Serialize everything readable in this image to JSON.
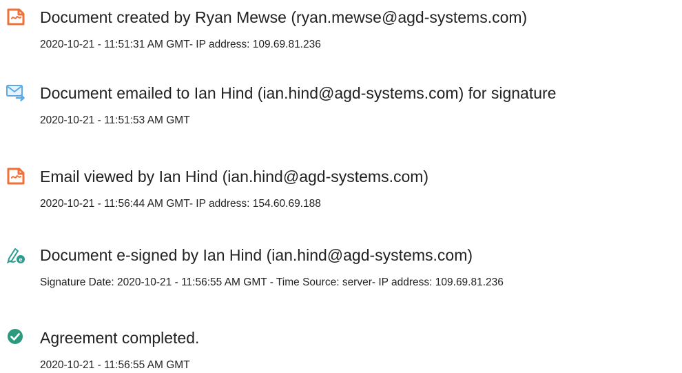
{
  "events": [
    {
      "icon": "document-created-icon",
      "title": "Document created by Ryan Mewse (ryan.mewse@agd-systems.com)",
      "detail": "2020-10-21 - 11:51:31 AM GMT- IP address: 109.69.81.236"
    },
    {
      "icon": "email-sent-icon",
      "title": "Document emailed to Ian Hind (ian.hind@agd-systems.com) for signature",
      "detail": "2020-10-21 - 11:51:53 AM GMT"
    },
    {
      "icon": "email-viewed-icon",
      "title": "Email viewed by Ian Hind (ian.hind@agd-systems.com)",
      "detail": "2020-10-21 - 11:56:44 AM GMT- IP address: 154.60.69.188"
    },
    {
      "icon": "e-signature-icon",
      "title": "Document e-signed by Ian Hind (ian.hind@agd-systems.com)",
      "detail": "Signature Date: 2020-10-21 - 11:56:55 AM GMT - Time Source: server- IP address: 109.69.81.236"
    },
    {
      "icon": "checkmark-circle-icon",
      "title": "Agreement completed.",
      "detail": "2020-10-21 - 11:56:55 AM GMT"
    }
  ],
  "colors": {
    "document_icon": "#f0703a",
    "email_icon": "#5aaae8",
    "signature_icon": "#2d9a8e",
    "complete_icon": "#2c9a7e",
    "text": "#222222"
  }
}
